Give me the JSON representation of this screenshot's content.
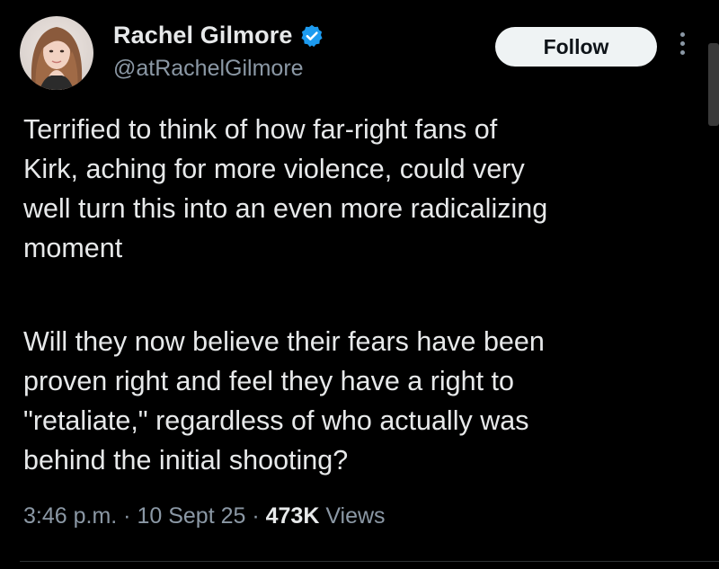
{
  "author": {
    "display_name": "Rachel Gilmore",
    "handle": "@atRachelGilmore",
    "verified_icon": "verified-badge-icon",
    "verified_color": "#1d9bf0"
  },
  "actions": {
    "follow_label": "Follow",
    "more_icon": "more-vertical-icon"
  },
  "tweet": {
    "paragraph_1": "Terrified to think of how far-right fans of\nKirk, aching for more violence, could very\nwell turn this into an even more radicalizing\nmoment",
    "paragraph_2": "Will they now believe their fears have been\nproven right and feel they have a right to\n\"retaliate,\" regardless of who actually was\nbehind the initial shooting?"
  },
  "meta": {
    "time": "3:46 p.m.",
    "separator_1": " · ",
    "date": "10 Sept 25",
    "separator_2": " · ",
    "views_count": "473K",
    "views_label": " Views"
  },
  "colors": {
    "background": "#000000",
    "primary_text": "#e7e9ea",
    "secondary_text": "#8b98a5",
    "follow_bg": "#eff3f4",
    "follow_text": "#0f1419"
  }
}
